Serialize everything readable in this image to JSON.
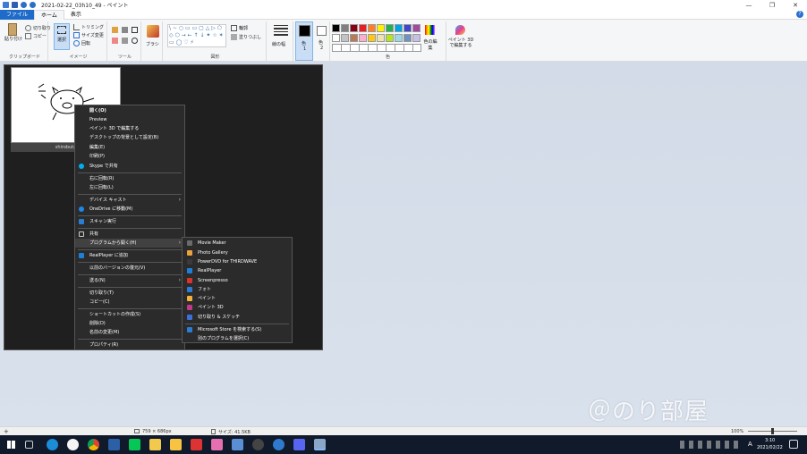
{
  "titlebar": {
    "title": "2021-02-22_03h10_49 - ペイント",
    "min": "—",
    "max": "❐",
    "close": "✕"
  },
  "menu": {
    "file": "ファイル",
    "home": "ホーム",
    "view": "表示",
    "help": "?"
  },
  "ribbon": {
    "clipboard": {
      "paste": "貼り付け",
      "cut": "切り取り",
      "copy": "コピー",
      "label": "クリップボード"
    },
    "image": {
      "select": "選択",
      "crop": "トリミング",
      "resize": "サイズ変更",
      "rotate": "回転",
      "label": "イメージ"
    },
    "tools": {
      "label": "ツール"
    },
    "brush": {
      "label": "ブラシ"
    },
    "shapes": {
      "outline": "輪郭",
      "fill": "塗りつぶし",
      "label": "図形"
    },
    "size": {
      "label": "線の幅"
    },
    "color1": {
      "label": "色",
      "sub": "1"
    },
    "color2": {
      "label": "色",
      "sub": "2"
    },
    "edit_colors": {
      "label": "色の編集"
    },
    "paint3d": {
      "label": "ペイント 3D で編集する"
    },
    "colors_label": "色"
  },
  "palette": [
    "#000000",
    "#7f7f7f",
    "#880015",
    "#ed1c24",
    "#ff7f27",
    "#fff200",
    "#22b14c",
    "#00a2e8",
    "#3f48cc",
    "#a349a4",
    "#ffffff",
    "#c3c3c3",
    "#b97a57",
    "#ffaec9",
    "#ffc90e",
    "#efe4b0",
    "#b5e61d",
    "#99d9ea",
    "#7092be",
    "#c8bfe7"
  ],
  "explorer": {
    "thumb_caption": "shirobuta"
  },
  "context_menu": [
    {
      "label": "開く(O)",
      "bold": true
    },
    {
      "label": "Preview"
    },
    {
      "label": "ペイント 3D で編集する"
    },
    {
      "label": "デスクトップの背景として設定(B)"
    },
    {
      "label": "編集(E)"
    },
    {
      "label": "印刷(P)"
    },
    {
      "label": "Skype で共有"
    },
    {
      "label": "右に回転(R)"
    },
    {
      "label": "左に回転(L)"
    },
    {
      "label": "デバイス キャスト"
    },
    {
      "label": "OneDrive に移動(M)"
    },
    {
      "label": "スキャン実行"
    },
    {
      "label": "共有"
    },
    {
      "label": "プログラムから開く(H)"
    },
    {
      "label": "RealPlayer に追加"
    },
    {
      "label": "以前のバージョンの復元(V)"
    },
    {
      "label": "送る(N)"
    },
    {
      "label": "切り取り(T)"
    },
    {
      "label": "コピー(C)"
    },
    {
      "label": "ショートカットの作成(S)"
    },
    {
      "label": "削除(D)"
    },
    {
      "label": "名前の変更(M)"
    },
    {
      "label": "プロパティ(R)"
    }
  ],
  "open_with": [
    {
      "label": "Movie Maker",
      "color": "#6b6b6b"
    },
    {
      "label": "Photo Gallery",
      "color": "#e8a33c"
    },
    {
      "label": "PowerDVD for THIRDWAVE",
      "color": "#3a3a3a"
    },
    {
      "label": "RealPlayer",
      "color": "#1e7fd8"
    },
    {
      "label": "Screenpresso",
      "color": "#d9332b"
    },
    {
      "label": "フォト",
      "color": "#2b7cd3"
    },
    {
      "label": "ペイント",
      "color": "#f0b23c"
    },
    {
      "label": "ペイント 3D",
      "color": "#c0398a"
    },
    {
      "label": "切り取り & スケッチ",
      "color": "#3c6fd8"
    },
    {
      "label": "Microsoft Store を検索する(S)",
      "color": "#2b7cd3"
    },
    {
      "label": "別のプログラムを選択(C)",
      "color": "#2b2b2b"
    }
  ],
  "statusbar": {
    "dimensions": "759 × 686px",
    "size": "サイズ: 41.5KB",
    "zoom": "100%"
  },
  "taskbar": {
    "time": "3:10",
    "date": "2021/02/22",
    "ime": "A"
  },
  "watermark": "＠のり部屋"
}
